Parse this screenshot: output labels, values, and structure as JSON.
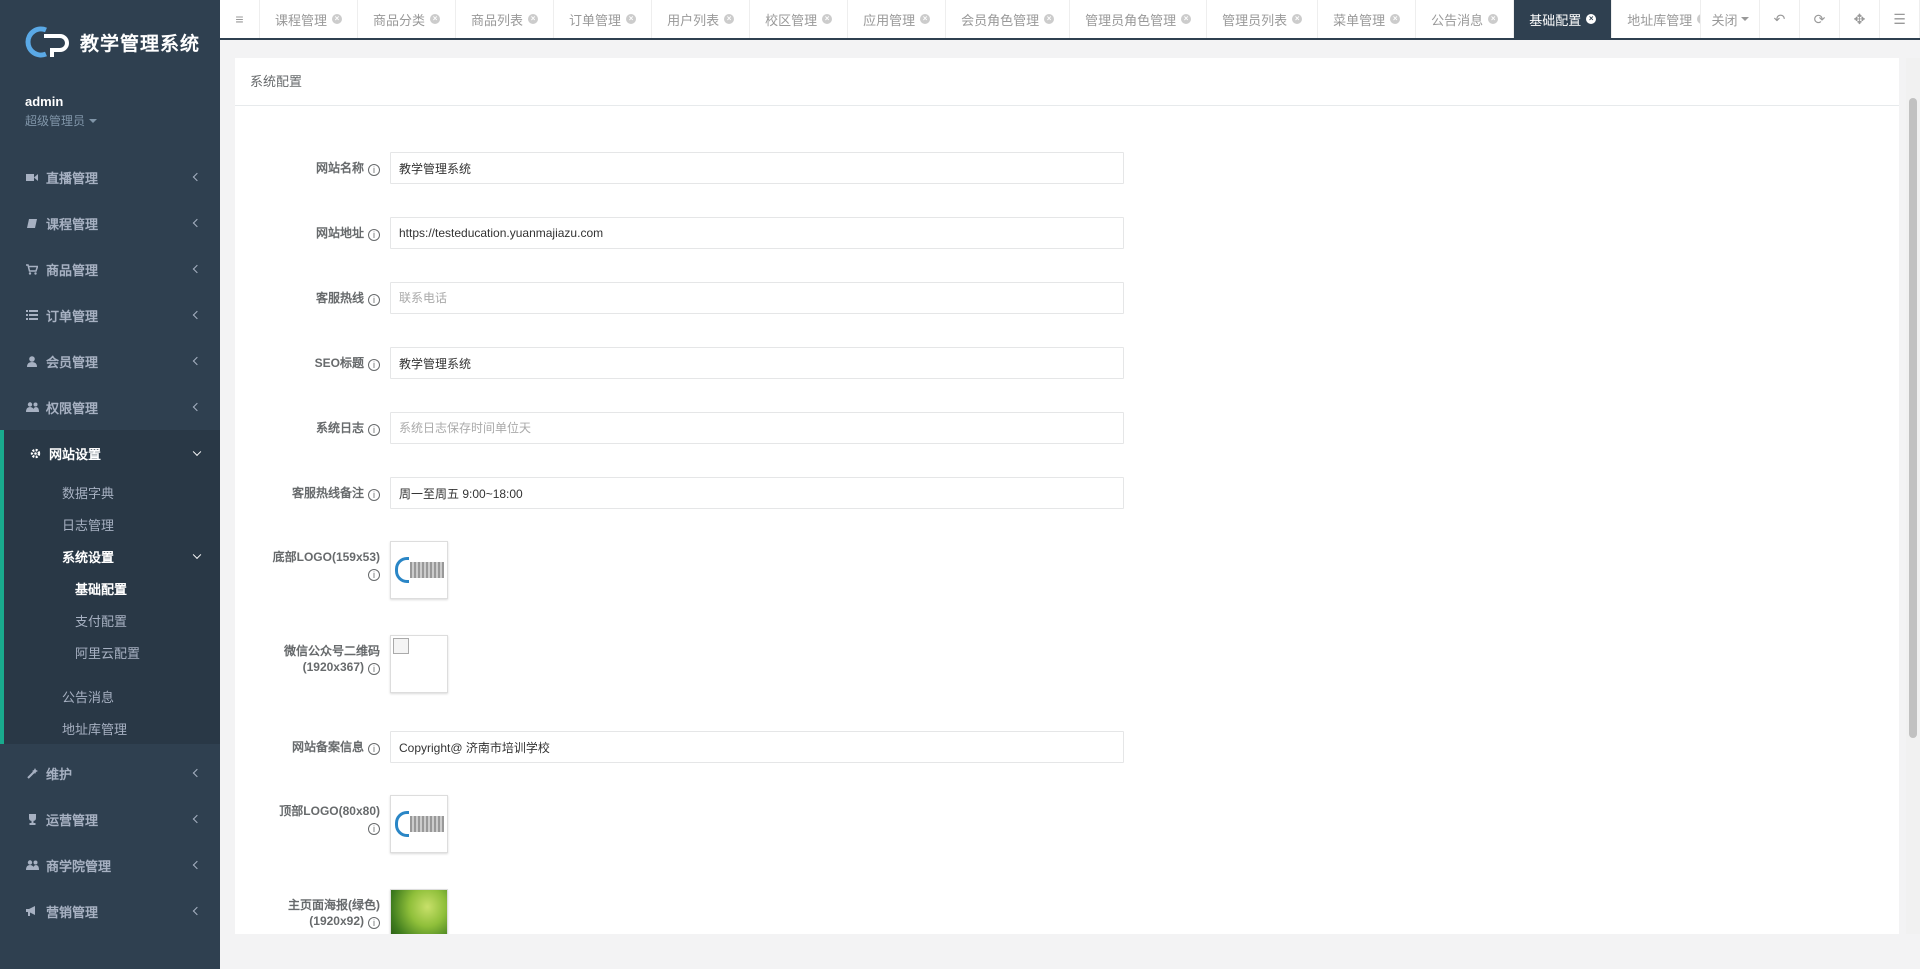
{
  "app": {
    "logo_text": "教学管理系统"
  },
  "profile": {
    "name": "admin",
    "role": "超级管理员"
  },
  "sidebar": {
    "items": [
      {
        "label": "直播管理"
      },
      {
        "label": "课程管理"
      },
      {
        "label": "商品管理"
      },
      {
        "label": "订单管理"
      },
      {
        "label": "会员管理"
      },
      {
        "label": "权限管理"
      }
    ],
    "open_group": {
      "label": "网站设置",
      "children": {
        "dict": "数据字典",
        "log": "日志管理",
        "system": "系统设置",
        "system_children": [
          "基础配置",
          "支付配置",
          "阿里云配置"
        ],
        "notice": "公告消息",
        "address": "地址库管理"
      }
    },
    "items_after": [
      {
        "label": "维护"
      },
      {
        "label": "运营管理"
      },
      {
        "label": "商学院管理"
      },
      {
        "label": "营销管理"
      }
    ]
  },
  "tabs": [
    "课程管理",
    "商品分类",
    "商品列表",
    "订单管理",
    "用户列表",
    "校区管理",
    "应用管理",
    "会员角色管理",
    "管理员角色管理",
    "管理员列表",
    "菜单管理",
    "公告消息",
    "基础配置",
    "地址库管理"
  ],
  "active_tab": "基础配置",
  "toolbar": {
    "close_label": "关闭"
  },
  "panel": {
    "title": "系统配置"
  },
  "form": {
    "site_name": {
      "label": "网站名称",
      "value": "教学管理系统"
    },
    "site_url": {
      "label": "网站地址",
      "value": "https://testeducation.yuanmajiazu.com"
    },
    "hotline": {
      "label": "客服热线",
      "placeholder": "联系电话"
    },
    "seo_title": {
      "label": "SEO标题",
      "value": "教学管理系统"
    },
    "sys_log": {
      "label": "系统日志",
      "placeholder": "系统日志保存时间单位天"
    },
    "hotline_note": {
      "label": "客服热线备注",
      "value": "周一至周五 9:00~18:00"
    },
    "bottom_logo": {
      "label": "底部LOGO(159x53)"
    },
    "wechat_qr": {
      "label": "微信公众号二维码(1920x367)"
    },
    "icp": {
      "label": "网站备案信息",
      "value": "Copyright@ 济南市培训学校"
    },
    "top_logo": {
      "label": "顶部LOGO(80x80)"
    },
    "poster": {
      "label": "主页面海报(绿色)(1920x92)"
    }
  },
  "colors": {
    "sidebar_bg": "#2f4050",
    "accent": "#19aa8d",
    "active_tab_bg": "#2f4050"
  }
}
